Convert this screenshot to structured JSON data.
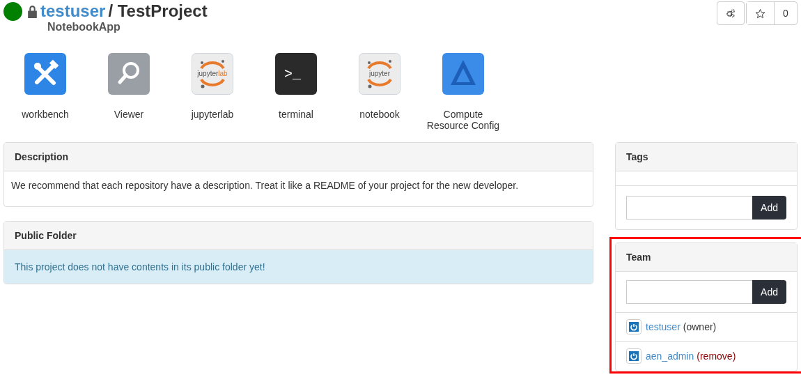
{
  "header": {
    "status_dot": {
      "color": "#008000"
    },
    "locked": true,
    "owner": "testuser",
    "separator": "/",
    "project": "TestProject",
    "subtitle": "NotebookApp",
    "star_count": "0"
  },
  "apps": [
    {
      "kind": "tools",
      "label": "workbench"
    },
    {
      "kind": "search",
      "label": "Viewer"
    },
    {
      "kind": "jupyter",
      "badge": "jupyter",
      "badge_suffix": "lab",
      "label": "jupyterlab"
    },
    {
      "kind": "terminal",
      "glyph": ">_",
      "label": "terminal"
    },
    {
      "kind": "jupyter",
      "badge": "jupyter",
      "label": "notebook"
    },
    {
      "kind": "compute",
      "label": "Compute Resource Config"
    }
  ],
  "description": {
    "title": "Description",
    "text": "We recommend that each repository have a description. Treat it like a README of your project for the new developer."
  },
  "public_folder": {
    "title": "Public Folder",
    "notice": "This project does not have contents in its public folder yet!"
  },
  "tags": {
    "title": "Tags",
    "add_button": "Add"
  },
  "team": {
    "title": "Team",
    "highlighted": true,
    "add_button": "Add",
    "members": [
      {
        "name": "testuser",
        "note": "(owner)",
        "kind": "role"
      },
      {
        "name": "aen_admin",
        "note": "(remove)",
        "kind": "action"
      }
    ]
  }
}
